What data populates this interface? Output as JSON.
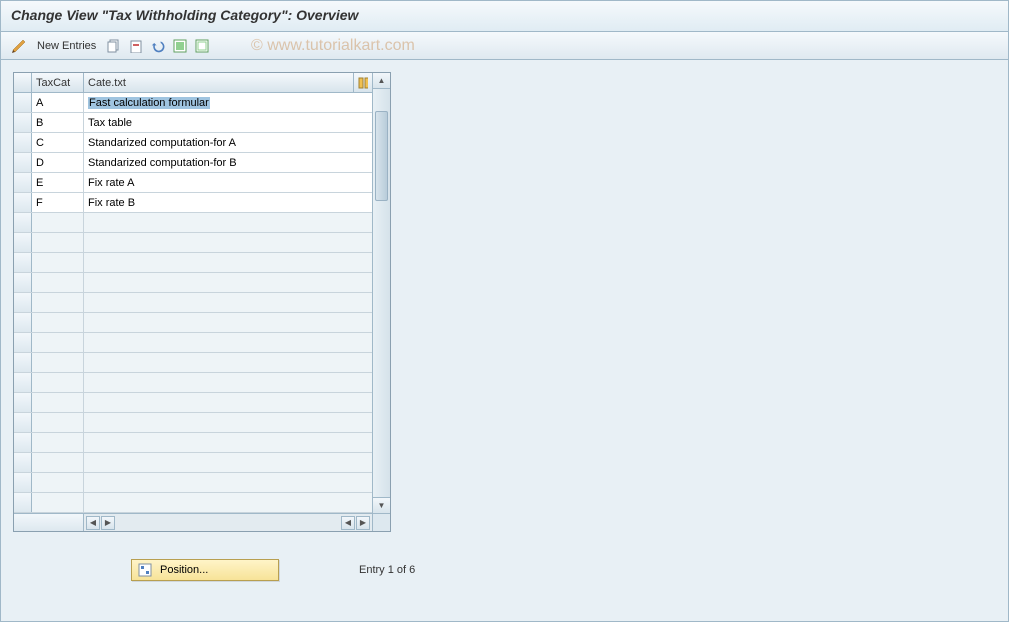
{
  "title": "Change View \"Tax Withholding Category\": Overview",
  "watermark": "© www.tutorialkart.com",
  "toolbar": {
    "new_entries": "New Entries"
  },
  "table": {
    "columns": {
      "cat": "TaxCat",
      "txt": "Cate.txt"
    },
    "rows": [
      {
        "cat": "A",
        "txt": "Fast calculation formular",
        "selected": true
      },
      {
        "cat": "B",
        "txt": "Tax table"
      },
      {
        "cat": "C",
        "txt": "Standarized computation-for A"
      },
      {
        "cat": "D",
        "txt": "Standarized computation-for B"
      },
      {
        "cat": "E",
        "txt": "Fix rate A"
      },
      {
        "cat": "F",
        "txt": "Fix rate B"
      }
    ],
    "empty_rows": 15
  },
  "footer": {
    "position_label": "Position...",
    "entry_text": "Entry 1 of 6"
  }
}
